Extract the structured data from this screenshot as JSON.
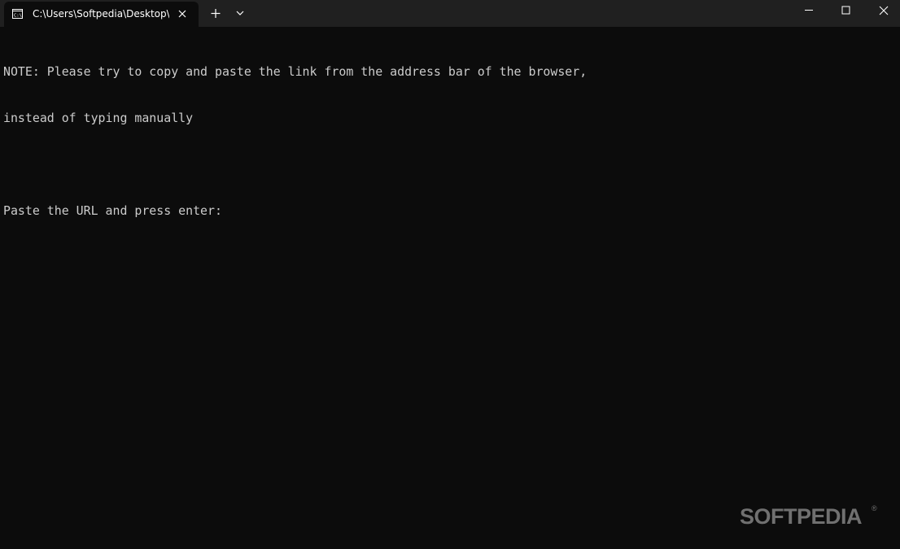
{
  "tab": {
    "title": "C:\\Users\\Softpedia\\Desktop\\url",
    "icon": "terminal-icon"
  },
  "titlebar_buttons": {
    "new_tab_icon": "plus-icon",
    "dropdown_icon": "chevron-down-icon",
    "minimize_icon": "minimize-icon",
    "maximize_icon": "maximize-icon",
    "close_icon": "close-icon"
  },
  "console": {
    "lines": [
      "NOTE: Please try to copy and paste the link from the address bar of the browser,",
      "instead of typing manually",
      "",
      "Paste the URL and press enter:"
    ]
  },
  "watermark": {
    "text": "SOFTPEDIA",
    "mark": "®"
  },
  "colors": {
    "background": "#0c0c0c",
    "titlebar": "#202020",
    "text": "#cccccc"
  }
}
